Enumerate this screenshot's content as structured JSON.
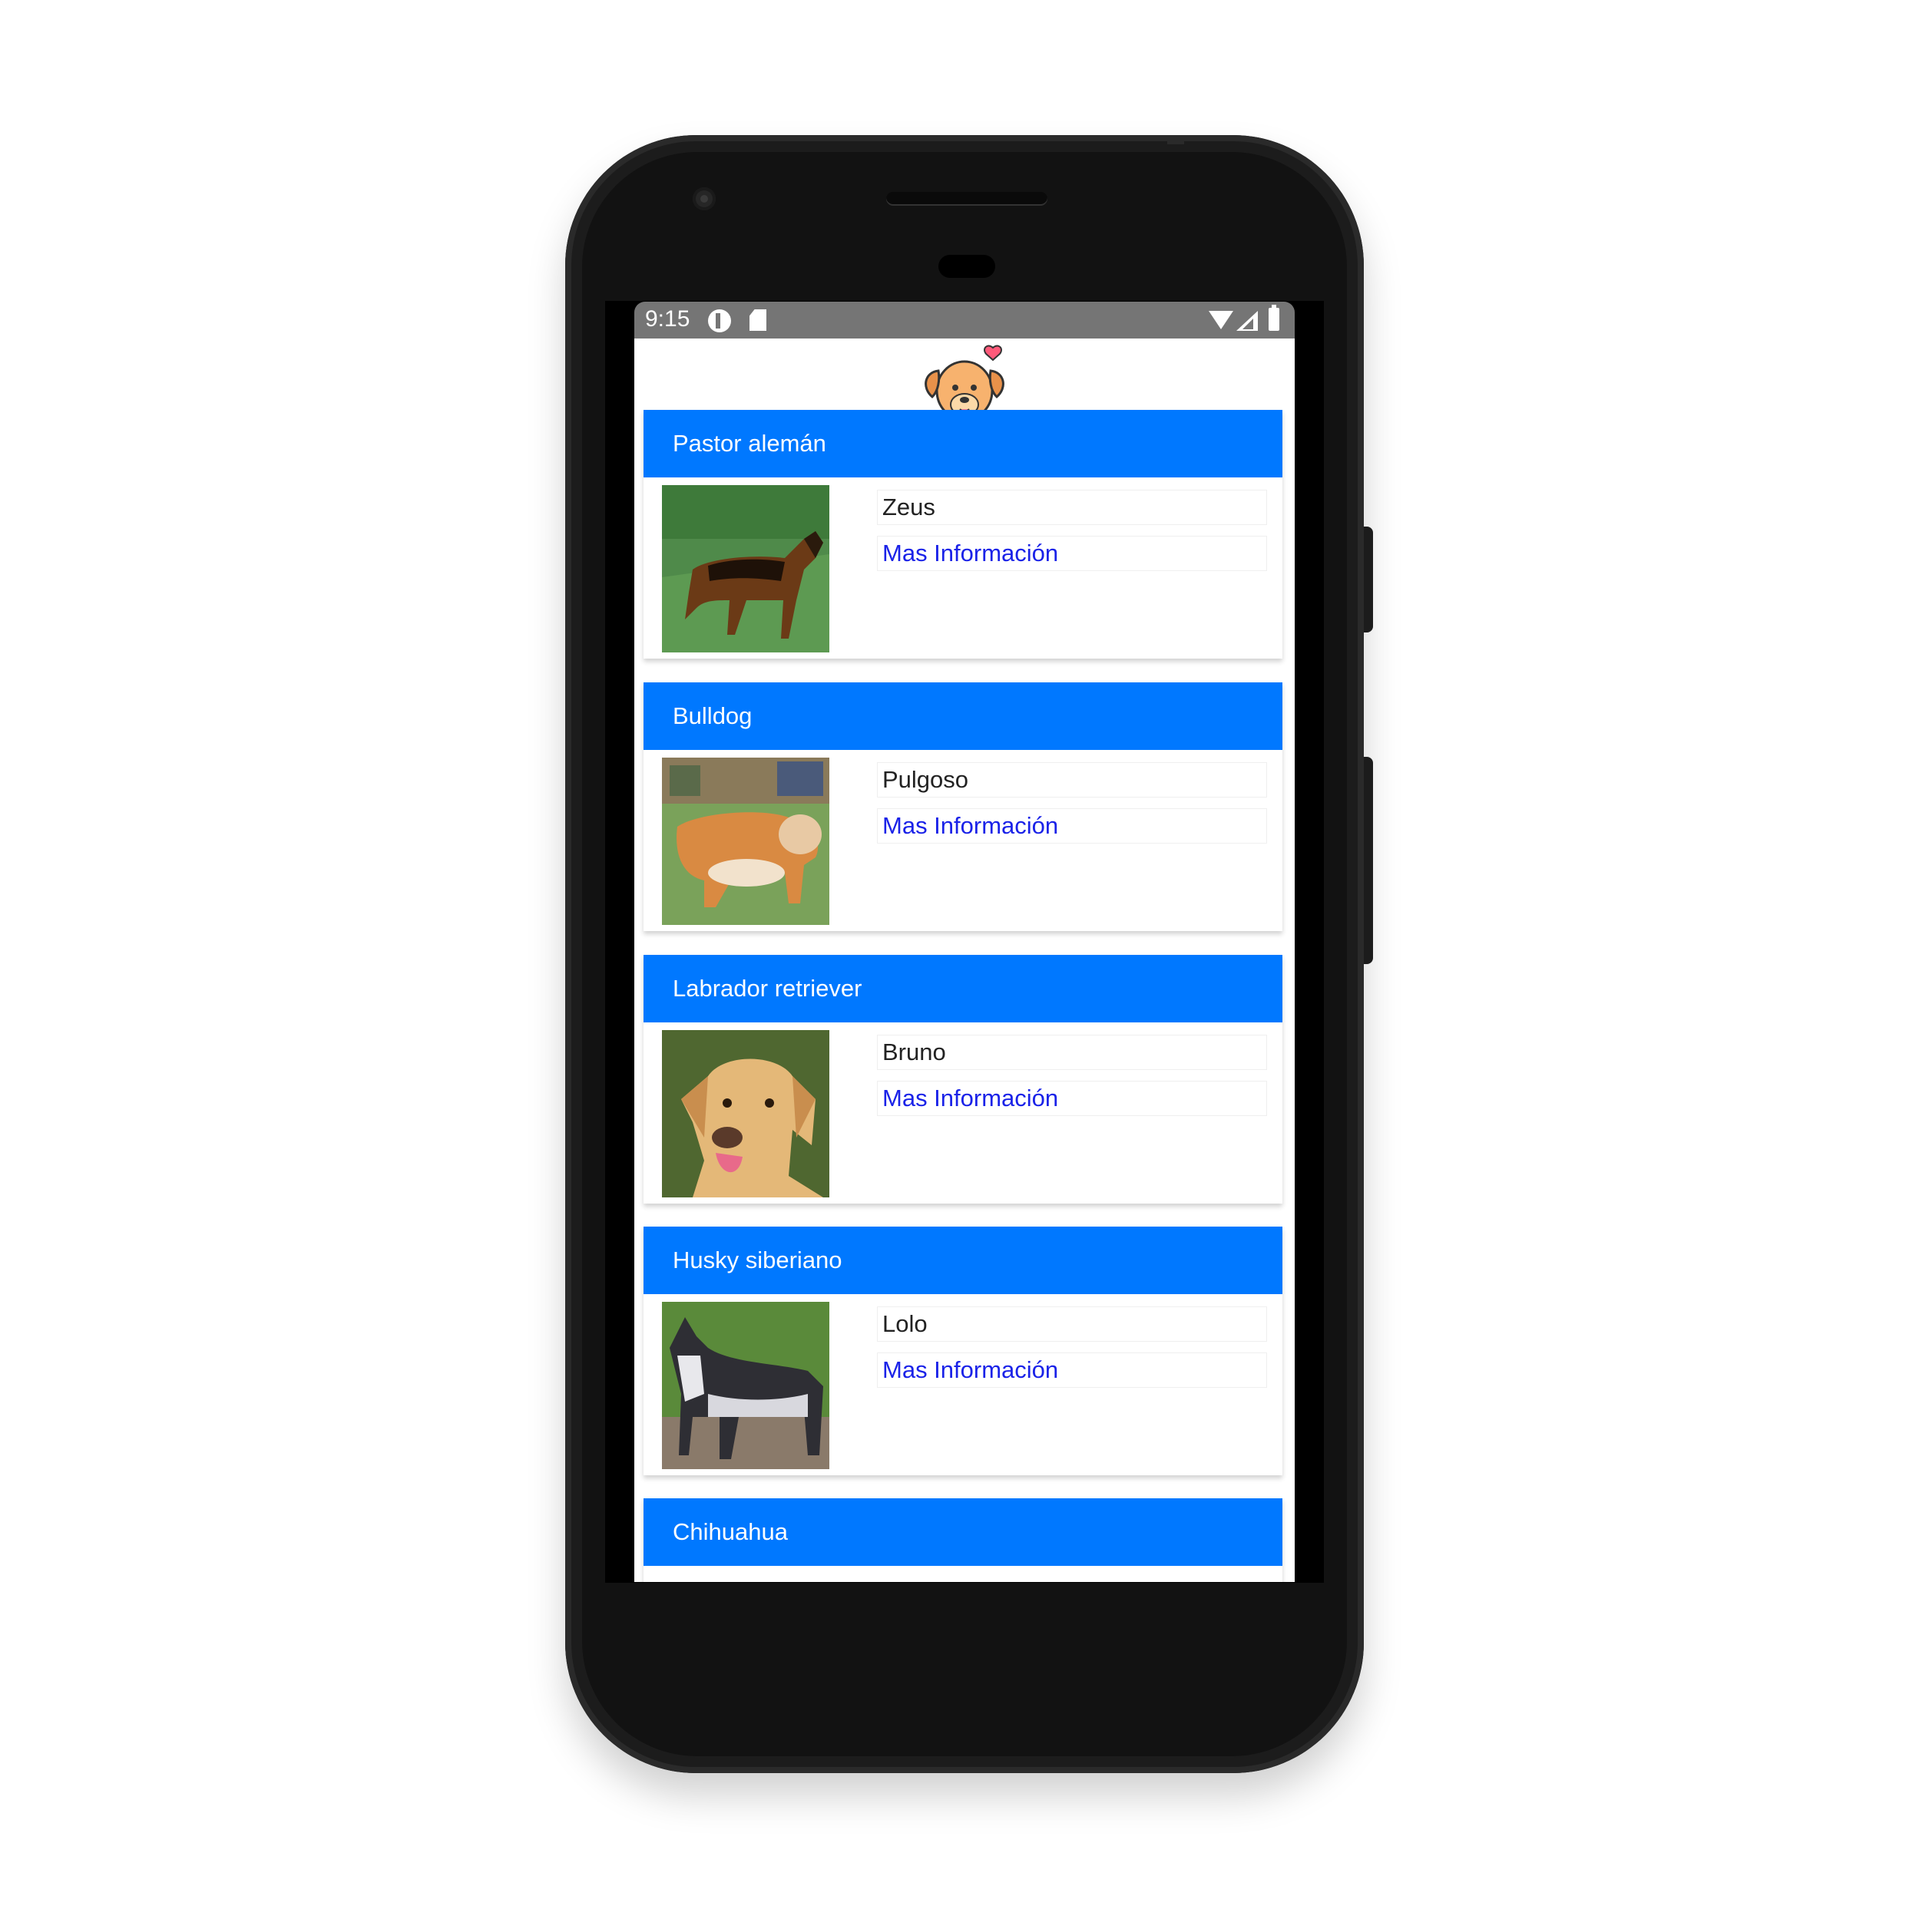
{
  "status_bar": {
    "time": "9:15"
  },
  "app": {
    "logo_icon": "dog-heart-icon"
  },
  "cards": [
    {
      "breed": "Pastor alemán",
      "name": "Zeus",
      "link": "Mas Información",
      "photo": "german-shepherd-photo"
    },
    {
      "breed": "Bulldog",
      "name": "Pulgoso",
      "link": "Mas Información",
      "photo": "bulldog-photo"
    },
    {
      "breed": "Labrador retriever",
      "name": "Bruno",
      "link": "Mas Información",
      "photo": "labrador-photo"
    },
    {
      "breed": "Husky siberiano",
      "name": "Lolo",
      "link": "Mas Información",
      "photo": "husky-photo"
    },
    {
      "breed": "Chihuahua"
    }
  ],
  "colors": {
    "header_blue": "#0078ff",
    "link_blue": "#1a22e8",
    "status_gray": "#757575"
  }
}
